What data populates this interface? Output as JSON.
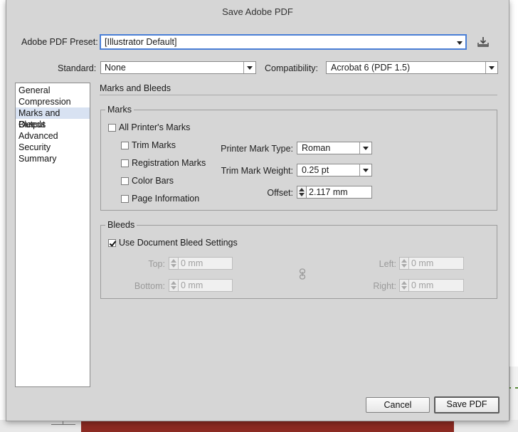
{
  "window": {
    "title": "Save Adobe PDF"
  },
  "preset": {
    "label": "Adobe PDF Preset:",
    "value": "[Illustrator Default]",
    "save_icon": "save-preset-icon"
  },
  "standard": {
    "label": "Standard:",
    "value": "None"
  },
  "compatibility": {
    "label": "Compatibility:",
    "value": "Acrobat 6 (PDF 1.5)"
  },
  "sidebar": {
    "items": [
      {
        "label": "General"
      },
      {
        "label": "Compression"
      },
      {
        "label": "Marks and Bleeds"
      },
      {
        "label": "Output"
      },
      {
        "label": "Advanced"
      },
      {
        "label": "Security"
      },
      {
        "label": "Summary"
      }
    ],
    "selected": "Marks and Bleeds"
  },
  "section": {
    "title": "Marks and Bleeds"
  },
  "marks": {
    "legend": "Marks",
    "all_printers_marks": {
      "label": "All Printer's Marks",
      "checked": false
    },
    "trim_marks": {
      "label": "Trim Marks",
      "checked": false
    },
    "registration_marks": {
      "label": "Registration Marks",
      "checked": false
    },
    "color_bars": {
      "label": "Color Bars",
      "checked": false
    },
    "page_information": {
      "label": "Page Information",
      "checked": false
    },
    "printer_mark_type": {
      "label": "Printer Mark Type:",
      "value": "Roman"
    },
    "trim_mark_weight": {
      "label": "Trim Mark Weight:",
      "value": "0.25 pt"
    },
    "offset": {
      "label": "Offset:",
      "value": "2.117 mm"
    }
  },
  "bleeds": {
    "legend": "Bleeds",
    "use_document_bleed": {
      "label": "Use Document Bleed Settings",
      "checked": true
    },
    "top": {
      "label": "Top:",
      "value": "0 mm"
    },
    "bottom": {
      "label": "Bottom:",
      "value": "0 mm"
    },
    "left": {
      "label": "Left:",
      "value": "0 mm"
    },
    "right": {
      "label": "Right:",
      "value": "0 mm"
    },
    "link_icon": "link-icon"
  },
  "buttons": {
    "cancel": "Cancel",
    "save": "Save PDF"
  },
  "colors": {
    "dialog_bg": "#d6d6d6",
    "selection": "#d8e2f2",
    "focus_ring": "#4a7fd6"
  }
}
